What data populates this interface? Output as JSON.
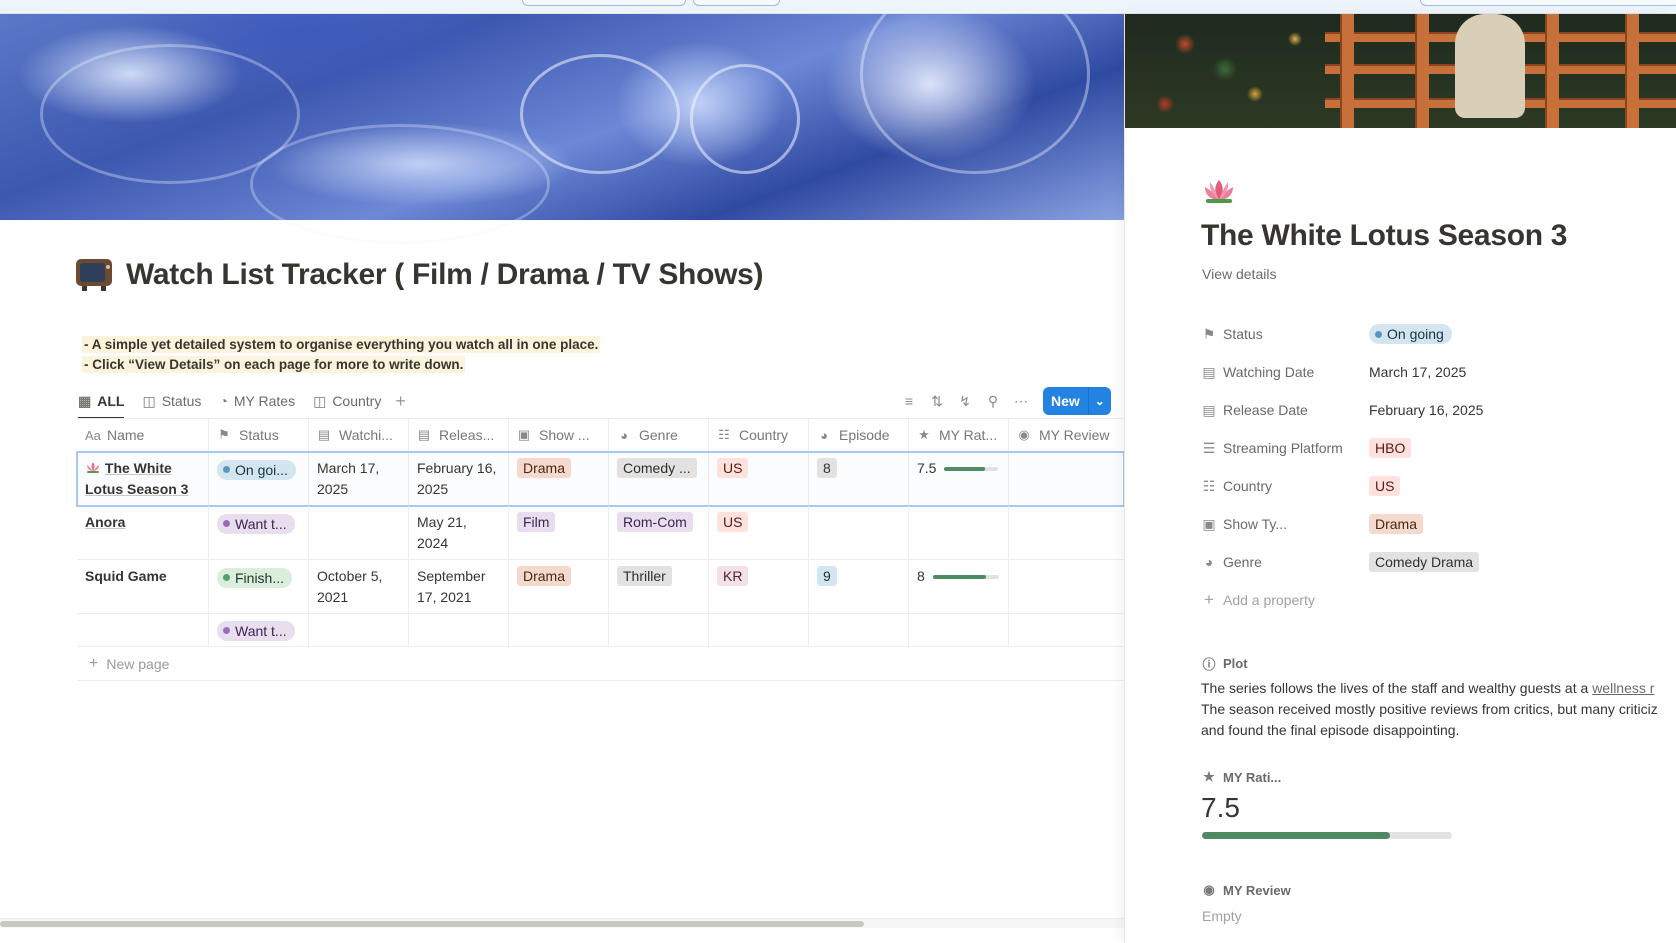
{
  "page": {
    "title": "Watch List Tracker ( Film / Drama / TV Shows)",
    "description": [
      "- A simple yet detailed system to organise everything you watch all in one place.",
      "- Click “View Details” on each page for more to write down."
    ]
  },
  "views": [
    {
      "label": "ALL",
      "icon": "table-icon"
    },
    {
      "label": "Status",
      "icon": "board-icon"
    },
    {
      "label": "MY Rates",
      "icon": "chart-icon"
    },
    {
      "label": "Country",
      "icon": "board-icon"
    }
  ],
  "toolbar": {
    "new_label": "New"
  },
  "table": {
    "columns": [
      "Name",
      "Status",
      "Watchi...",
      "Releas...",
      "Show ...",
      "Genre",
      "Country",
      "Episode",
      "MY Rat...",
      "MY Review"
    ],
    "rows": [
      {
        "name": "The White Lotus Season 3",
        "status": "On goi...",
        "watching": "March 17, 2025",
        "release": "February 16, 2025",
        "show": "Drama",
        "genre": "Comedy ...",
        "country": "US",
        "episode": "8",
        "rating": "7.5",
        "rating_value": 7.5
      },
      {
        "name": "Anora",
        "status": "Want t...",
        "watching": "",
        "release": "May 21, 2024",
        "show": "Film",
        "genre": "Rom-Com",
        "country": "US",
        "episode": "",
        "rating": "",
        "rating_value": null
      },
      {
        "name": "Squid Game",
        "status": "Finish...",
        "watching": "October 5, 2021",
        "release": "September 17, 2021",
        "show": "Drama",
        "genre": "Thriller",
        "country": "KR",
        "episode": "9",
        "rating": "8",
        "rating_value": 8
      },
      {
        "name": "",
        "status": "Want t...",
        "watching": "",
        "release": "",
        "show": "",
        "genre": "",
        "country": "",
        "episode": "",
        "rating": "",
        "rating_value": null
      }
    ],
    "new_page_label": "New page",
    "rating_max": 10
  },
  "peek": {
    "title": "The White Lotus Season 3",
    "view_details": "View details",
    "properties": [
      {
        "name": "Status",
        "value": "On going",
        "icon": "bookmark-icon"
      },
      {
        "name": "Watching Date",
        "value": "March 17, 2025",
        "icon": "calendar-icon"
      },
      {
        "name": "Release Date",
        "value": "February 16, 2025",
        "icon": "calendar-icon"
      },
      {
        "name": "Streaming Platform",
        "value": "HBO",
        "icon": "list-icon"
      },
      {
        "name": "Country",
        "value": "US",
        "icon": "globe-icon"
      },
      {
        "name": "Show Ty...",
        "value": "Drama",
        "icon": "couch-icon"
      },
      {
        "name": "Genre",
        "value": "Comedy Drama",
        "icon": "genre-icon"
      }
    ],
    "add_property": "Add a property",
    "plot_label": "Plot",
    "plot_line1_start": " The series follows the lives of the staff and wealthy guests at a ",
    "plot_link": "wellness r",
    "plot_line2": "The season received mostly positive reviews from critics, but many criticiz",
    "plot_line3": "and found the final episode disappointing.",
    "rating_label": "MY Rati...",
    "rating": "7.5",
    "rating_value": 7.5,
    "review_label": "MY Review",
    "review_value": "Empty"
  },
  "colors": {
    "accent": "#2383e2",
    "rating_fill": "#4f8a62"
  }
}
